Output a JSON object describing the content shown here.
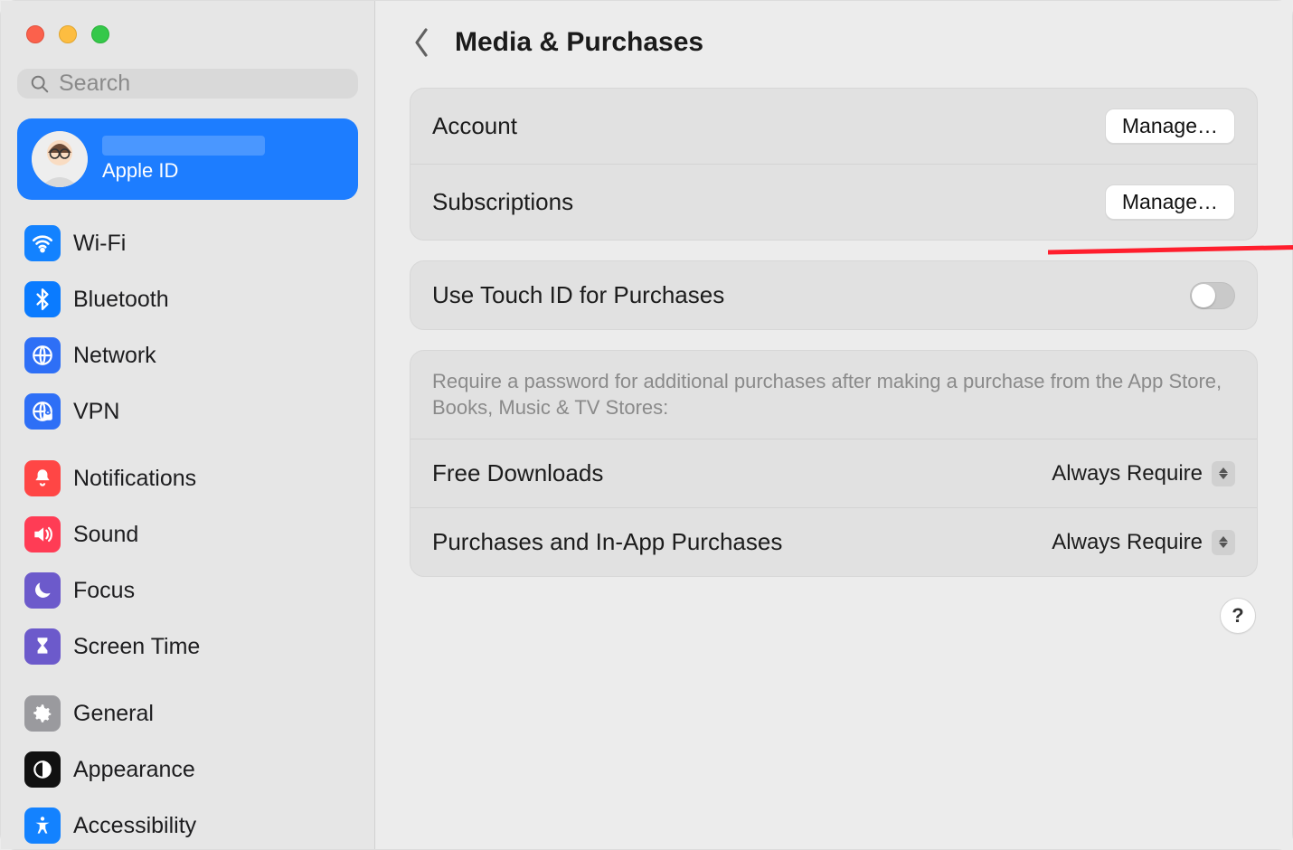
{
  "header": {
    "title": "Media & Purchases"
  },
  "search": {
    "placeholder": "Search"
  },
  "user": {
    "subtitle": "Apple ID"
  },
  "sidebar": {
    "group1": [
      {
        "label": "Wi-Fi"
      },
      {
        "label": "Bluetooth"
      },
      {
        "label": "Network"
      },
      {
        "label": "VPN"
      }
    ],
    "group2": [
      {
        "label": "Notifications"
      },
      {
        "label": "Sound"
      },
      {
        "label": "Focus"
      },
      {
        "label": "Screen Time"
      }
    ],
    "group3": [
      {
        "label": "General"
      },
      {
        "label": "Appearance"
      },
      {
        "label": "Accessibility"
      }
    ]
  },
  "card1": {
    "account_label": "Account",
    "account_btn": "Manage…",
    "subscriptions_label": "Subscriptions",
    "subscriptions_btn": "Manage…"
  },
  "card2": {
    "touchid_label": "Use Touch ID for Purchases"
  },
  "card3": {
    "description": "Require a password for additional purchases after making a purchase from the App Store, Books, Music & TV Stores:",
    "free_label": "Free Downloads",
    "free_value": "Always Require",
    "purchases_label": "Purchases and In-App Purchases",
    "purchases_value": "Always Require"
  },
  "help": {
    "label": "?"
  }
}
